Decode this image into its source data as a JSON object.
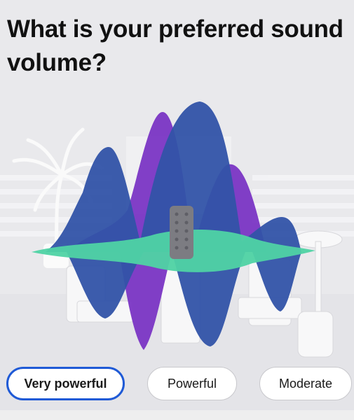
{
  "question": {
    "title": "What is your preferred sound volume?"
  },
  "options": [
    {
      "label": "Very powerful",
      "selected": true
    },
    {
      "label": "Powerful",
      "selected": false
    },
    {
      "label": "Moderate",
      "selected": false
    }
  ],
  "colors": {
    "accent": "#1f5ad6",
    "wave_blue": "#3153a8",
    "wave_purple": "#7a35c4",
    "wave_teal": "#4fd3a4"
  }
}
